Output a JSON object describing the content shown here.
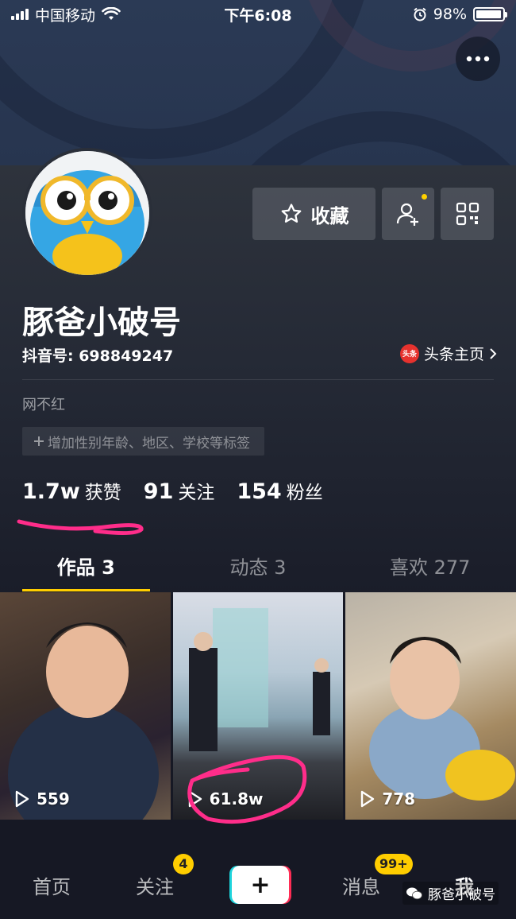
{
  "status_bar": {
    "carrier": "中国移动",
    "time": "下午6:08",
    "battery": "98%",
    "battery_level": 0.98
  },
  "profile": {
    "nickname": "豚爸小破号",
    "douyin_id": "抖音号: 698849247",
    "toutiao_logo_text": "头条",
    "toutiao_link": "头条主页",
    "bio": "网不红",
    "add_tags": "增加性别年龄、地区、学校等标签",
    "collect_label": "收藏"
  },
  "stats": [
    {
      "value": "1.7w",
      "label": "获赞"
    },
    {
      "value": "91",
      "label": "关注"
    },
    {
      "value": "154",
      "label": "粉丝"
    }
  ],
  "tabs": [
    {
      "label": "作品 3",
      "active": true
    },
    {
      "label": "动态 3",
      "active": false
    },
    {
      "label": "喜欢 277",
      "active": false
    }
  ],
  "videos": [
    {
      "play_count": "559"
    },
    {
      "play_count": "61.8w"
    },
    {
      "play_count": "778"
    }
  ],
  "bottom_nav": {
    "home": "首页",
    "follow": "关注",
    "follow_badge": "4",
    "messages": "消息",
    "messages_badge": "99+",
    "me": "我"
  },
  "watermark": "豚爸小破号",
  "colors": {
    "accent": "#ffcd00",
    "annotation": "#ff2d8a",
    "background": "#161824"
  }
}
